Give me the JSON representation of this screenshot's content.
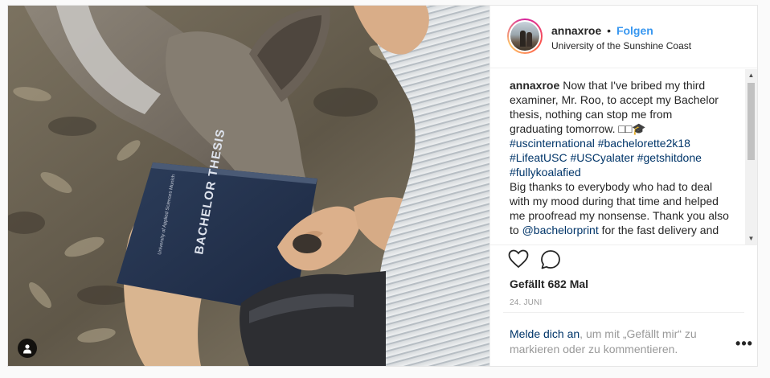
{
  "post": {
    "username": "annaxroe",
    "separator": "•",
    "follow_label": "Folgen",
    "location": "University of the Sunshine Coast",
    "caption": {
      "username": "annaxroe",
      "lines": [
        "Now that I've bribed my third",
        "examiner, Mr. Roo, to accept my Bachelor",
        "thesis, nothing can stop me from",
        "graduating tomorrow. □□🎓"
      ],
      "hashtags_line1": "#uscinternational #bachelorette2k18",
      "hashtags_line2": "#LifeatUSC #USCyalater #getshitdone",
      "hashtags_line3": "#fullykoalafied",
      "thanks_lines": [
        "Big thanks to everybody who had to deal",
        "with my mood during that time and helped",
        "me proofread my nonsense. Thank you also"
      ],
      "mention_prefix": "to ",
      "mention": "@bachelorprint",
      "mention_suffix": " for the fast delivery and"
    },
    "likes": "Gefällt 682 Mal",
    "date": "24. JUNI",
    "login": {
      "link": "Melde dich an",
      "text": ", um mit „Gefällt mir“ zu markieren oder zu kommentieren."
    },
    "more_label": "•••",
    "photo_book_title": "BACHELOR THESIS",
    "photo_book_subtitle": "University of Applied Sciences Munich"
  },
  "icons": {
    "like": "heart-icon",
    "comment": "comment-icon",
    "user_tag": "user-tag-icon"
  },
  "colors": {
    "accent": "#3897f0",
    "link": "#003569",
    "muted": "#999999",
    "text": "#262626"
  }
}
